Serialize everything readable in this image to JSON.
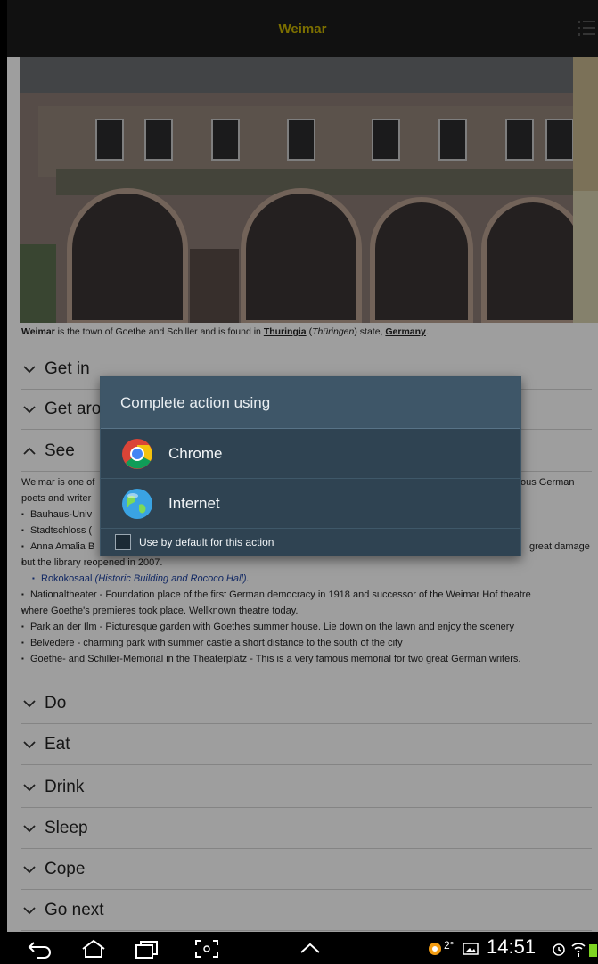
{
  "appbar": {
    "title": "Weimar"
  },
  "intro": {
    "strong": "Weimar",
    "text1": " is the town of Goethe and Schiller and is found in ",
    "link1": "Thuringia",
    "text2": " (",
    "italic": "Thüringen",
    "text3": ") state, ",
    "link2": "Germany",
    "text4": "."
  },
  "sections": {
    "get_in": "Get in",
    "get_around": "Get arou",
    "see": "See",
    "do": "Do",
    "eat": "Eat",
    "drink": "Drink",
    "sleep": "Sleep",
    "cope": "Cope",
    "go_next": "Go next"
  },
  "see_body": {
    "para_left": "Weimar is one of",
    "para_right": "ous German",
    "para_line2": "poets and writer",
    "items": [
      "Bauhaus-Univ",
      "Stadtschloss (",
      "Anna Amalia B",
      "great damage"
    ],
    "library_line": "but the library reopened in 2007.",
    "sub_item_link": "Rokokosaal",
    "sub_item_text": " (Historic Building and Rococo Hall).",
    "more_items": [
      "Nationaltheater - Foundation place of the first German democracy in 1918 and successor of the Weimar Hof theatre",
      "where Goethe's premieres took place. Wellknown theatre today.",
      "Park an der Ilm - Picturesque garden with Goethes summer house. Lie down on the lawn and enjoy the scenery",
      "Belvedere - charming park with summer castle a short distance to the south of the city",
      "Goethe- and Schiller-Memorial in the Theaterplatz - This is a very famous memorial for two great German writers."
    ]
  },
  "dialog": {
    "title": "Complete action using",
    "option1": "Chrome",
    "option2": "Internet",
    "checkbox_label": "Use by default for this action"
  },
  "statusbar": {
    "temperature": "2°",
    "time": "14:51"
  }
}
